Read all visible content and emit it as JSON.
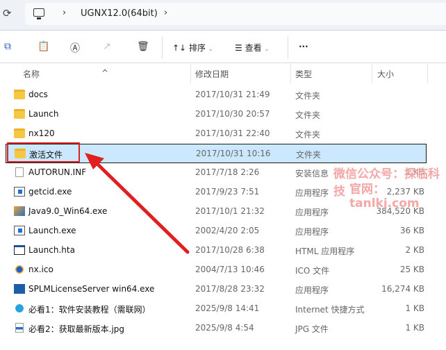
{
  "address": {
    "crumbs": [
      "UGNX12.0(64bit)"
    ]
  },
  "toolbar": {
    "sort_label": "排序",
    "view_label": "查看",
    "more_label": "···"
  },
  "columns": {
    "name": "名称",
    "date": "修改日期",
    "type": "类型",
    "size": "大小"
  },
  "files": [
    {
      "name": "docs",
      "date": "2017/10/31 21:49",
      "type": "文件夹",
      "size": "",
      "icon": "folder"
    },
    {
      "name": "Launch",
      "date": "2017/10/30 20:57",
      "type": "文件夹",
      "size": "",
      "icon": "folder"
    },
    {
      "name": "nx120",
      "date": "2017/10/31 22:40",
      "type": "文件夹",
      "size": "",
      "icon": "folder"
    },
    {
      "name": "激活文件",
      "date": "2017/10/31 10:16",
      "type": "文件夹",
      "size": "",
      "icon": "folder",
      "selected": true
    },
    {
      "name": "AUTORUN.INF",
      "date": "2017/7/18 2:26",
      "type": "安装信息",
      "size": "1 KB",
      "icon": "file"
    },
    {
      "name": "getcid.exe",
      "date": "2017/9/23 7:51",
      "type": "应用程序",
      "size": "2,237 KB",
      "icon": "exe"
    },
    {
      "name": "Java9.0_Win64.exe",
      "date": "2017/10/1 21:32",
      "type": "应用程序",
      "size": "384,520 KB",
      "icon": "java"
    },
    {
      "name": "Launch.exe",
      "date": "2002/4/20 2:05",
      "type": "应用程序",
      "size": "36 KB",
      "icon": "exe"
    },
    {
      "name": "Launch.hta",
      "date": "2017/10/28 6:38",
      "type": "HTML 应用程序",
      "size": "2 KB",
      "icon": "hta"
    },
    {
      "name": "nx.ico",
      "date": "2004/7/13 10:46",
      "type": "ICO 文件",
      "size": "25 KB",
      "icon": "ico"
    },
    {
      "name": "SPLMLicenseServer win64.exe",
      "date": "2017/8/28 23:32",
      "type": "应用程序",
      "size": "16,274 KB",
      "icon": "splm"
    },
    {
      "name": "必看1：软件安装教程（需联网）",
      "date": "2025/9/8 14:41",
      "type": "Internet 快捷方式",
      "size": "1 KB",
      "icon": "web"
    },
    {
      "name": "必看2：获取最新版本.jpg",
      "date": "2025/9/8 4:54",
      "type": "JPG 文件",
      "size": "1 KB",
      "icon": "jpg"
    }
  ],
  "watermark": {
    "line1": "微信公众号：探临科技",
    "line2": "官网：tanlkj.com"
  }
}
